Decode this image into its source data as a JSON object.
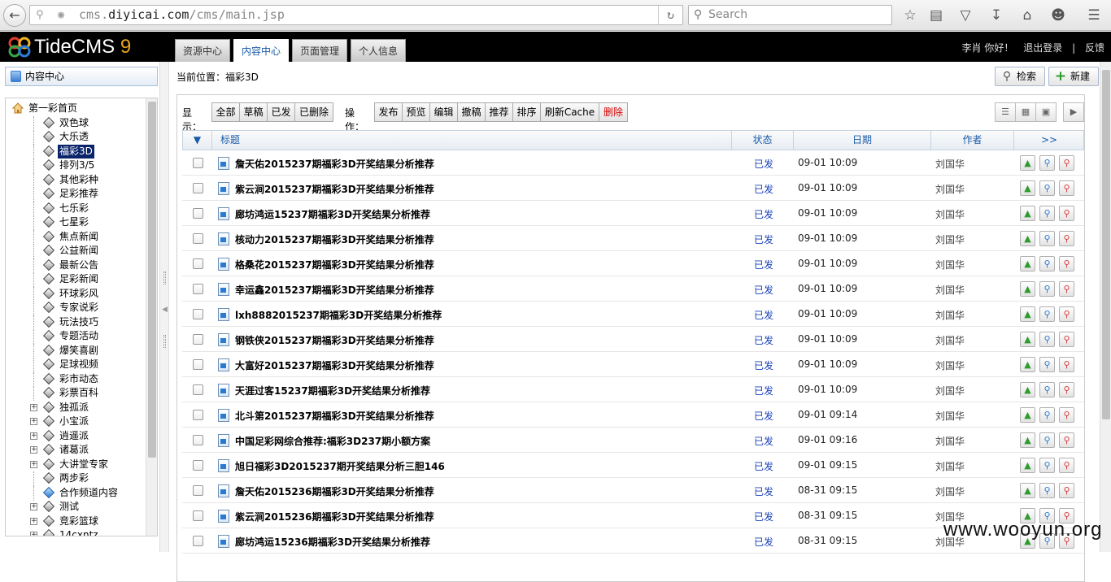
{
  "browser": {
    "url_prefix": "cms.",
    "url_host": "diyicai.com",
    "url_path": "/cms/main.jsp",
    "search_placeholder": "Search"
  },
  "header": {
    "logo_text": "TideCMS",
    "logo_version": "9",
    "tabs": [
      {
        "label": "资源中心"
      },
      {
        "label": "内容中心",
        "active": true
      },
      {
        "label": "页面管理"
      },
      {
        "label": "个人信息"
      }
    ],
    "greeting": "李肖 你好！",
    "logout": "退出登录",
    "separator": "|",
    "feedback": "反馈"
  },
  "sidebar": {
    "title": "内容中心",
    "root": "第一彩首页",
    "items": [
      {
        "label": "双色球",
        "expandable": false
      },
      {
        "label": "大乐透",
        "expandable": false
      },
      {
        "label": "福彩3D",
        "expandable": false,
        "selected": true
      },
      {
        "label": "排列3/5",
        "expandable": false
      },
      {
        "label": "其他彩种",
        "expandable": false
      },
      {
        "label": "足彩推荐",
        "expandable": false
      },
      {
        "label": "七乐彩",
        "expandable": false
      },
      {
        "label": "七星彩",
        "expandable": false
      },
      {
        "label": "焦点新闻",
        "expandable": false
      },
      {
        "label": "公益新闻",
        "expandable": false
      },
      {
        "label": "最新公告",
        "expandable": false
      },
      {
        "label": "足彩新闻",
        "expandable": false
      },
      {
        "label": "环球彩风",
        "expandable": false
      },
      {
        "label": "专家说彩",
        "expandable": false
      },
      {
        "label": "玩法技巧",
        "expandable": false
      },
      {
        "label": "专题活动",
        "expandable": false
      },
      {
        "label": "爆笑喜剧",
        "expandable": false
      },
      {
        "label": "足球视频",
        "expandable": false
      },
      {
        "label": "彩市动态",
        "expandable": false
      },
      {
        "label": "彩票百科",
        "expandable": false
      },
      {
        "label": "独孤派",
        "expandable": true
      },
      {
        "label": "小宝派",
        "expandable": true
      },
      {
        "label": "逍遥派",
        "expandable": true
      },
      {
        "label": "诸葛派",
        "expandable": true
      },
      {
        "label": "大讲堂专家",
        "expandable": true
      },
      {
        "label": "两步彩",
        "expandable": false
      },
      {
        "label": "合作频道内容",
        "expandable": false,
        "blue": true
      },
      {
        "label": "测试",
        "expandable": true
      },
      {
        "label": "竞彩篮球",
        "expandable": true
      },
      {
        "label": "14cxntz",
        "expandable": true
      }
    ]
  },
  "main": {
    "breadcrumb": "当前位置：福彩3D",
    "search_button": "检索",
    "new_button": "新建",
    "display_label": "显示：",
    "display_filters": [
      "全部",
      "草稿",
      "已发",
      "已删除"
    ],
    "ops_label": "操作：",
    "ops": [
      "发布",
      "预览",
      "编辑",
      "撤稿",
      "推荐",
      "排序",
      "刷新Cache",
      "删除"
    ],
    "columns": {
      "title": "标题",
      "status": "状态",
      "date": "日期",
      "author": "作者",
      "more": ">>"
    },
    "rows": [
      {
        "title": "詹天佑2015237期福彩3D开奖结果分析推荐",
        "status": "已发",
        "date": "09-01 10:09",
        "author": "刘国华"
      },
      {
        "title": "紫云涧2015237期福彩3D开奖结果分析推荐",
        "status": "已发",
        "date": "09-01 10:09",
        "author": "刘国华"
      },
      {
        "title": "廊坊鸿运15237期福彩3D开奖结果分析推荐",
        "status": "已发",
        "date": "09-01 10:09",
        "author": "刘国华"
      },
      {
        "title": "核动力2015237期福彩3D开奖结果分析推荐",
        "status": "已发",
        "date": "09-01 10:09",
        "author": "刘国华"
      },
      {
        "title": "格桑花2015237期福彩3D开奖结果分析推荐",
        "status": "已发",
        "date": "09-01 10:09",
        "author": "刘国华"
      },
      {
        "title": "幸运鑫2015237期福彩3D开奖结果分析推荐",
        "status": "已发",
        "date": "09-01 10:09",
        "author": "刘国华"
      },
      {
        "title": "lxh8882015237期福彩3D开奖结果分析推荐",
        "status": "已发",
        "date": "09-01 10:09",
        "author": "刘国华"
      },
      {
        "title": "钢铁侠2015237期福彩3D开奖结果分析推荐",
        "status": "已发",
        "date": "09-01 10:09",
        "author": "刘国华"
      },
      {
        "title": "大富好2015237期福彩3D开奖结果分析推荐",
        "status": "已发",
        "date": "09-01 10:09",
        "author": "刘国华"
      },
      {
        "title": "天涯过客15237期福彩3D开奖结果分析推荐",
        "status": "已发",
        "date": "09-01 10:09",
        "author": "刘国华"
      },
      {
        "title": "北斗第2015237期福彩3D开奖结果分析推荐",
        "status": "已发",
        "date": "09-01 09:14",
        "author": "刘国华"
      },
      {
        "title": "中国足彩网综合推荐:福彩3D237期小额方案",
        "status": "已发",
        "date": "09-01 09:16",
        "author": "刘国华"
      },
      {
        "title": "旭日福彩3D2015237期开奖结果分析三胆146",
        "status": "已发",
        "date": "09-01 09:15",
        "author": "刘国华"
      },
      {
        "title": "詹天佑2015236期福彩3D开奖结果分析推荐",
        "status": "已发",
        "date": "08-31 09:15",
        "author": "刘国华"
      },
      {
        "title": "紫云涧2015236期福彩3D开奖结果分析推荐",
        "status": "已发",
        "date": "08-31 09:15",
        "author": "刘国华"
      },
      {
        "title": "廊坊鸿运15236期福彩3D开奖结果分析推荐",
        "status": "已发",
        "date": "08-31 09:15",
        "author": "刘国华"
      }
    ]
  },
  "watermark": "www.wooyun.org",
  "colors": {
    "accent": "#1a5aa8",
    "status_published": "#1a40b8",
    "delete_red": "#d40000",
    "header_bg": "#000000"
  }
}
